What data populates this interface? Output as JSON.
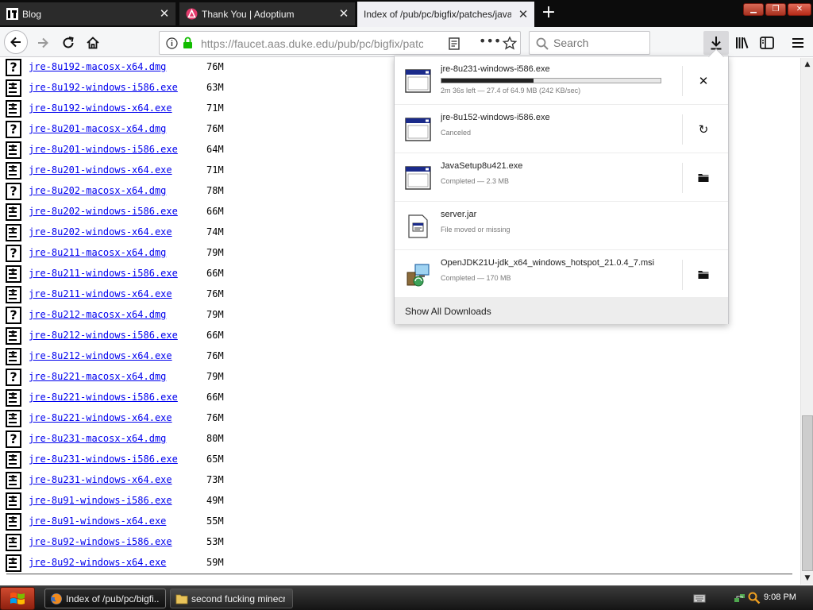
{
  "tabs": [
    {
      "title": "Blog",
      "icon": "blog-favicon"
    },
    {
      "title": "Thank You | Adoptium",
      "icon": "adoptium-icon"
    },
    {
      "title": "Index of /pub/pc/bigfix/patches/java",
      "icon": "none",
      "active": true
    }
  ],
  "toolbar": {
    "url": "https://faucet.aas.duke.edu/pub/pc/bigfix/patches/java/",
    "search_placeholder": "Search"
  },
  "files": [
    {
      "name": "jre-8u192-macosx-x64.dmg",
      "size": "76M",
      "icon": "unknown-file-icon"
    },
    {
      "name": "jre-8u192-windows-i586.exe",
      "size": "63M",
      "icon": "binary-file-icon"
    },
    {
      "name": "jre-8u192-windows-x64.exe",
      "size": "71M",
      "icon": "binary-file-icon"
    },
    {
      "name": "jre-8u201-macosx-x64.dmg",
      "size": "76M",
      "icon": "unknown-file-icon"
    },
    {
      "name": "jre-8u201-windows-i586.exe",
      "size": "64M",
      "icon": "binary-file-icon"
    },
    {
      "name": "jre-8u201-windows-x64.exe",
      "size": "71M",
      "icon": "binary-file-icon"
    },
    {
      "name": "jre-8u202-macosx-x64.dmg",
      "size": "78M",
      "icon": "unknown-file-icon"
    },
    {
      "name": "jre-8u202-windows-i586.exe",
      "size": "66M",
      "icon": "binary-file-icon"
    },
    {
      "name": "jre-8u202-windows-x64.exe",
      "size": "74M",
      "icon": "binary-file-icon"
    },
    {
      "name": "jre-8u211-macosx-x64.dmg",
      "size": "79M",
      "icon": "unknown-file-icon"
    },
    {
      "name": "jre-8u211-windows-i586.exe",
      "size": "66M",
      "icon": "binary-file-icon"
    },
    {
      "name": "jre-8u211-windows-x64.exe",
      "size": "76M",
      "icon": "binary-file-icon"
    },
    {
      "name": "jre-8u212-macosx-x64.dmg",
      "size": "79M",
      "icon": "unknown-file-icon"
    },
    {
      "name": "jre-8u212-windows-i586.exe",
      "size": "66M",
      "icon": "binary-file-icon"
    },
    {
      "name": "jre-8u212-windows-x64.exe",
      "size": "76M",
      "icon": "binary-file-icon"
    },
    {
      "name": "jre-8u221-macosx-x64.dmg",
      "size": "79M",
      "icon": "unknown-file-icon"
    },
    {
      "name": "jre-8u221-windows-i586.exe",
      "size": "66M",
      "icon": "binary-file-icon"
    },
    {
      "name": "jre-8u221-windows-x64.exe",
      "size": "76M",
      "icon": "binary-file-icon"
    },
    {
      "name": "jre-8u231-macosx-x64.dmg",
      "size": "80M",
      "icon": "unknown-file-icon"
    },
    {
      "name": "jre-8u231-windows-i586.exe",
      "size": "65M",
      "icon": "binary-file-icon"
    },
    {
      "name": "jre-8u231-windows-x64.exe",
      "size": "73M",
      "icon": "binary-file-icon"
    },
    {
      "name": "jre-8u91-windows-i586.exe",
      "size": "49M",
      "icon": "binary-file-icon"
    },
    {
      "name": "jre-8u91-windows-x64.exe",
      "size": "55M",
      "icon": "binary-file-icon"
    },
    {
      "name": "jre-8u92-windows-i586.exe",
      "size": "53M",
      "icon": "binary-file-icon"
    },
    {
      "name": "jre-8u92-windows-x64.exe",
      "size": "59M",
      "icon": "binary-file-icon"
    }
  ],
  "downloads": {
    "items": [
      {
        "name": "jre-8u231-windows-i586.exe",
        "status": "2m 36s left — 27.4 of 64.9 MB (242 KB/sec)",
        "progress": 0.42,
        "action": "cancel-icon",
        "file_icon": "exe-file-icon"
      },
      {
        "name": "jre-8u152-windows-i586.exe",
        "status": "Canceled",
        "action": "retry-icon",
        "file_icon": "exe-file-icon"
      },
      {
        "name": "JavaSetup8u421.exe",
        "status": "Completed — 2.3 MB",
        "action": "folder-icon",
        "file_icon": "exe-file-icon"
      },
      {
        "name": "server.jar",
        "status": "File moved or missing",
        "action": "none",
        "file_icon": "jar-file-icon"
      },
      {
        "name": "OpenJDK21U-jdk_x64_windows_hotspot_21.0.4_7.msi",
        "status": "Completed — 170 MB",
        "action": "folder-icon",
        "file_icon": "msi-installer-icon"
      }
    ],
    "show_all": "Show All Downloads"
  },
  "taskbar": {
    "tasks": [
      {
        "label": "Index of /pub/pc/bigfi...",
        "icon": "firefox-icon",
        "active": true
      },
      {
        "label": "second fucking minecr...",
        "icon": "folder-icon",
        "active": false
      }
    ],
    "clock": "9:08 PM"
  },
  "colors": {
    "link": "#0000ee",
    "tab_strip": "#0c0c0c",
    "window_close": "#c4321f",
    "taskbar": "#1e1e1e"
  }
}
